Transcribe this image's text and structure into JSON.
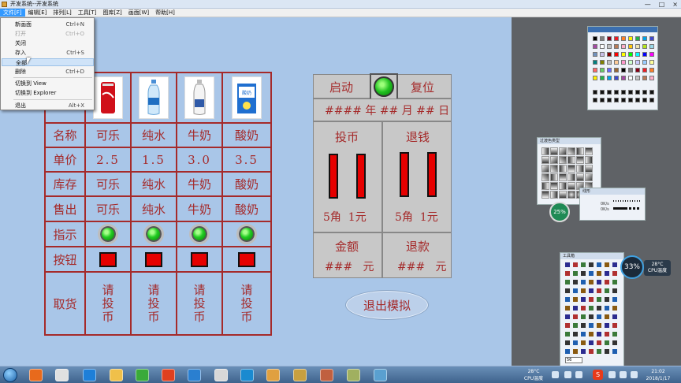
{
  "window": {
    "title": "开发系统--开发系统",
    "controls": [
      "—",
      "□",
      "×"
    ]
  },
  "menu": [
    {
      "label": "文件[F]",
      "active": true
    },
    {
      "label": "编辑[E]"
    },
    {
      "label": "排列[L]"
    },
    {
      "label": "工具[T]"
    },
    {
      "label": "图库[Z]"
    },
    {
      "label": "画面[W]"
    },
    {
      "label": "帮助[H]"
    }
  ],
  "file_menu": [
    {
      "label": "新画面",
      "shortcut": "Ctrl+N"
    },
    {
      "label": "打开",
      "shortcut": "Ctrl+O",
      "disabled": true
    },
    {
      "label": "关闭",
      "shortcut": ""
    },
    {
      "label": "存入",
      "shortcut": "Ctrl+S"
    },
    {
      "label": "全部",
      "shortcut": "",
      "highlighted": true
    },
    {
      "label": "删除",
      "shortcut": "Ctrl+D"
    },
    {
      "label": "切换到 View",
      "shortcut": ""
    },
    {
      "label": "切换到 Explorer",
      "shortcut": ""
    },
    {
      "label": "退出",
      "shortcut": "Alt+X"
    }
  ],
  "vending": {
    "row_labels": [
      "名称",
      "单价",
      "库存",
      "售出",
      "指示",
      "按钮",
      "取货"
    ],
    "products": [
      {
        "name": "可乐",
        "price": "2.5",
        "stock": "可乐",
        "sold": "可乐",
        "pickup": "请投币",
        "image": "cola-can"
      },
      {
        "name": "纯水",
        "price": "1.5",
        "stock": "纯水",
        "sold": "纯水",
        "pickup": "请投币",
        "image": "water-bottle"
      },
      {
        "name": "牛奶",
        "price": "3.0",
        "stock": "牛奶",
        "sold": "牛奶",
        "pickup": "请投币",
        "image": "milk-bottle"
      },
      {
        "name": "酸奶",
        "price": "3.5",
        "stock": "酸奶",
        "sold": "酸奶",
        "pickup": "请投币",
        "image": "yogurt-box"
      }
    ],
    "pickup_chars": [
      "请",
      "投",
      "币"
    ]
  },
  "panel": {
    "start_label": "启动",
    "reset_label": "复位",
    "date_text": "#### 年 ## 月 ## 日",
    "coin_in_label": "投币",
    "refund_label": "退钱",
    "coin_values": "5角  1元",
    "refund_values": "5角  1元",
    "amount_label": "金额",
    "amount_value": "###   元",
    "refund_amount_label": "退款",
    "refund_amount_value": "###   元",
    "exit_label": "退出模拟"
  },
  "side_windows": {
    "filter_title": "过渡色类型",
    "line_title": "线形",
    "toolbox_title": "工具箱",
    "mem_gauge": "25%",
    "cpu_gauge": "33%",
    "cpu_temp": "28°C",
    "cpu_temp_label": "CPU温度",
    "line_rates": [
      "0K/s",
      "0K/s"
    ],
    "toolbox_field": "56"
  },
  "taskbar": {
    "tray_temp": "28°C",
    "tray_temp_label": "CPU温度",
    "tray_ime": "S",
    "time": "21:02",
    "date": "2018/1/17"
  }
}
